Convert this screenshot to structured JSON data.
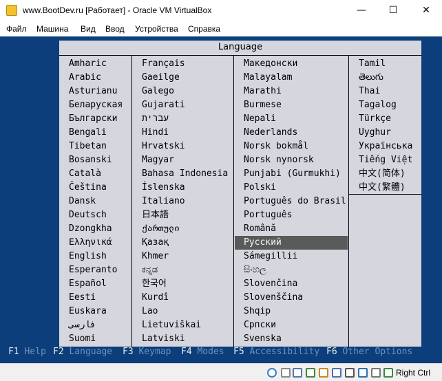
{
  "window": {
    "title": "www.BootDev.ru [Работает] - Oracle VM VirtualBox",
    "minimize": "—",
    "maximize": "☐",
    "close": "✕"
  },
  "menu": [
    "Файл",
    "Машина",
    "Вид",
    "Ввод",
    "Устройства",
    "Справка"
  ],
  "dialog": {
    "title": "Language",
    "columns": [
      [
        "Amharic",
        "Arabic",
        "Asturianu",
        "Беларуская",
        "Български",
        "Bengali",
        "Tibetan",
        "Bosanski",
        "Català",
        "Čeština",
        "Dansk",
        "Deutsch",
        "Dzongkha",
        "Ελληνικά",
        "English",
        "Esperanto",
        "Español",
        "Eesti",
        "Euskara",
        "فارسی",
        "Suomi"
      ],
      [
        "Français",
        "Gaeilge",
        "Galego",
        "Gujarati",
        "עברית",
        "Hindi",
        "Hrvatski",
        "Magyar",
        "Bahasa Indonesia",
        "Íslenska",
        "Italiano",
        "日本語",
        "ქართული",
        "Қазақ",
        "Khmer",
        "ಕನ್ನಡ",
        "한국어",
        "Kurdî",
        "Lao",
        "Lietuviškai",
        "Latviski"
      ],
      [
        "Македонски",
        "Malayalam",
        "Marathi",
        "Burmese",
        "Nepali",
        "Nederlands",
        "Norsk bokmål",
        "Norsk nynorsk",
        "Punjabi (Gurmukhi)",
        "Polski",
        "Português do Brasil",
        "Português",
        "Română",
        "Русский",
        "Sámegillii",
        "සිංහල",
        "Slovenčina",
        "Slovenščina",
        "Shqip",
        "Српски",
        "Svenska"
      ],
      [
        "Tamil",
        "తెలుగు",
        "Thai",
        "Tagalog",
        "Türkçe",
        "Uyghur",
        "Українська",
        "Tiếng Việt",
        "中文(简体)",
        "中文(繁體)"
      ]
    ],
    "selected": "Русский"
  },
  "function_keys": [
    {
      "key": "F1",
      "label": "Help"
    },
    {
      "key": "F2",
      "label": "Language"
    },
    {
      "key": "F3",
      "label": "Keymap"
    },
    {
      "key": "F4",
      "label": "Modes"
    },
    {
      "key": "F5",
      "label": "Accessibility"
    },
    {
      "key": "F6",
      "label": "Other Options"
    }
  ],
  "status_bar": {
    "icons": [
      "optical-disk-icon",
      "audio-icon",
      "usb-icon",
      "network-icon",
      "shared-folders-icon",
      "display-icon",
      "video-capture-icon",
      "cpu-icon",
      "mouse-integration-icon",
      "keyboard-capture-icon"
    ],
    "host_key": "Right Ctrl"
  },
  "colors": {
    "vm_background": "#0b3e7a",
    "dialog_background": "#d5d6de",
    "selection": "#595a5a",
    "fkey_label": "#6b93c4"
  }
}
